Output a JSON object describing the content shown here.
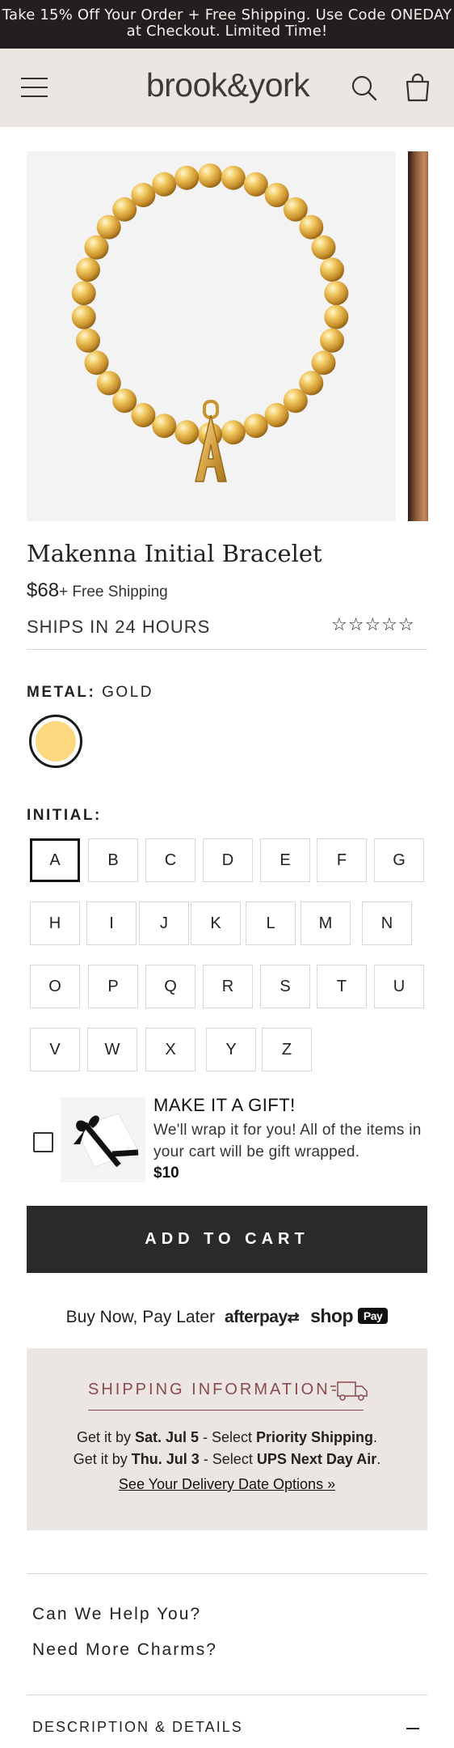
{
  "promo": {
    "text": "Take 15% Off Your Order + Free Shipping. Use Code ONEDAY at Checkout. Limited Time!"
  },
  "header": {
    "logo": "brook&york"
  },
  "product": {
    "title": "Makenna Initial Bracelet",
    "price": "$68",
    "shipping_note": "+ Free Shipping",
    "ships_in": "SHIPS IN 24 HOURS",
    "stars": "☆☆☆☆☆"
  },
  "metal": {
    "label": "METAL:",
    "value": "GOLD",
    "swatch_color": "#fdd87e"
  },
  "initial": {
    "label": "INITIAL:",
    "selected": "A",
    "letters": [
      "A",
      "B",
      "C",
      "D",
      "E",
      "F",
      "G",
      "H",
      "I",
      "J",
      "K",
      "L",
      "M",
      "N",
      "O",
      "P",
      "Q",
      "R",
      "S",
      "T",
      "U",
      "V",
      "W",
      "X",
      "Y",
      "Z"
    ]
  },
  "gift": {
    "title": "MAKE IT A GIFT!",
    "description": "We'll wrap it for you! All of the items in your cart will be gift wrapped.",
    "price": "$10"
  },
  "cart": {
    "button_label": "ADD TO CART"
  },
  "bnpl": {
    "text": "Buy Now, Pay Later",
    "afterpay": "afterpay",
    "shop": "shop",
    "pay": "Pay"
  },
  "shipping_info": {
    "title": "SHIPPING INFORMATION",
    "line1": {
      "pre": "Get it by ",
      "date": "Sat. Jul 5",
      "mid": " - Select ",
      "method": "Priority Shipping",
      "post": "."
    },
    "line2": {
      "pre": "Get it by ",
      "date": "Thu. Jul 3",
      "mid": " - Select ",
      "method": "UPS Next Day Air",
      "post": "."
    },
    "link": "See Your Delivery Date Options »"
  },
  "help": {
    "can_we_help": "Can We Help You?",
    "more_charms": "Need More Charms?"
  },
  "details": {
    "label": "DESCRIPTION & DETAILS"
  },
  "colors": {
    "accent": "#8a4a52",
    "dark": "#2a2a2a",
    "header_bg": "#ebe6e2"
  }
}
